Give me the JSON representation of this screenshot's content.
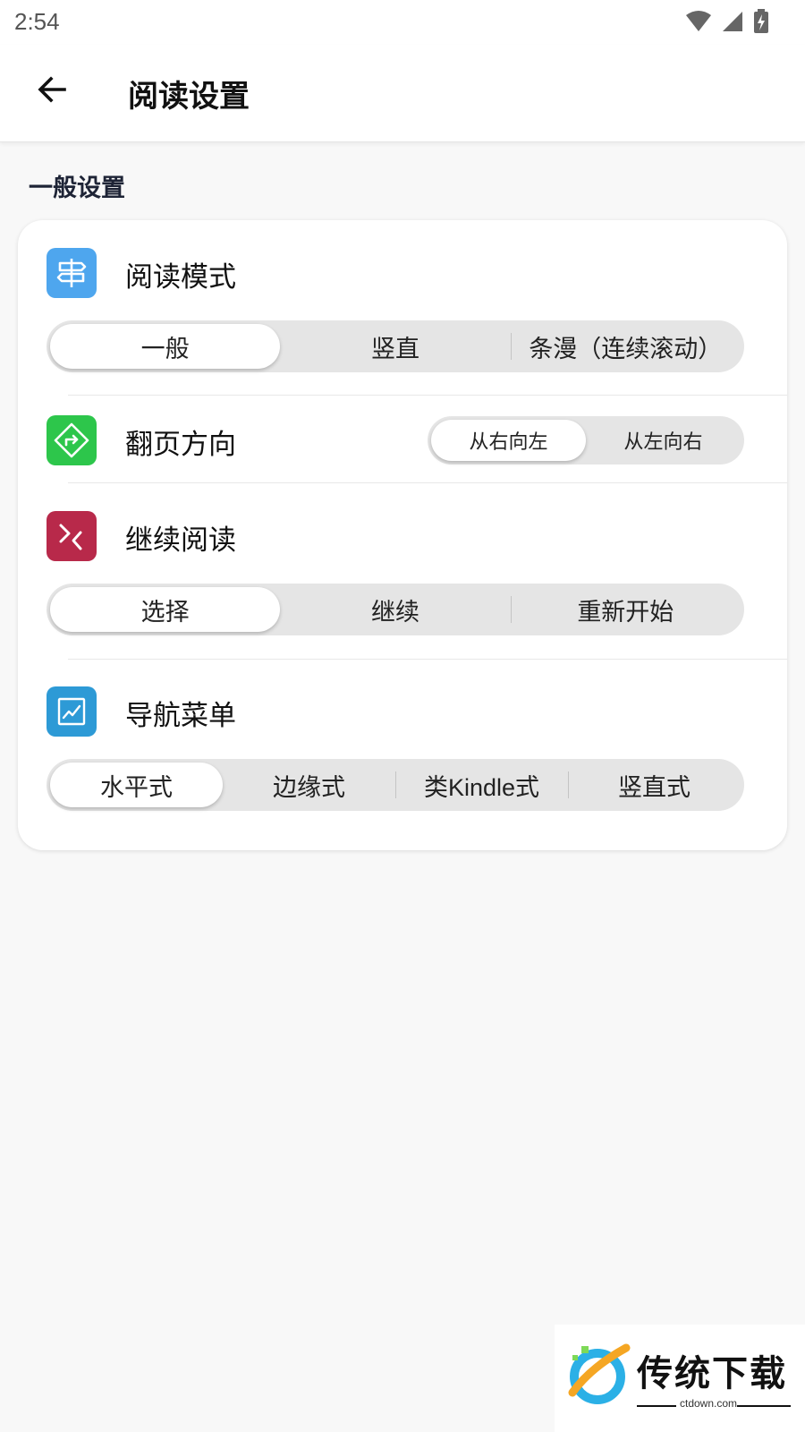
{
  "status_bar": {
    "time": "2:54",
    "icons": [
      "wifi-icon",
      "signal-icon",
      "battery-charging-icon"
    ]
  },
  "header": {
    "title": "阅读设置",
    "back_icon": "arrow-left-icon"
  },
  "section": {
    "title": "一般设置"
  },
  "settings": {
    "reading_mode": {
      "label": "阅读模式",
      "icon": "signpost-icon",
      "icon_color": "#4ea6ee",
      "options": [
        "一般",
        "竖直",
        "条漫（连续滚动）"
      ],
      "selected": "一般"
    },
    "page_direction": {
      "label": "翻页方向",
      "icon": "direction-sign-icon",
      "icon_color": "#2dc64b",
      "options": [
        "从右向左",
        "从左向右"
      ],
      "selected": "从右向左"
    },
    "continue_reading": {
      "label": "继续阅读",
      "icon": "chevrons-icon",
      "icon_color": "#b8294a",
      "options": [
        "选择",
        "继续",
        "重新开始"
      ],
      "selected": "选择"
    },
    "nav_menu": {
      "label": "导航菜单",
      "icon": "line-chart-icon",
      "icon_color": "#2d9ad6",
      "options": [
        "水平式",
        "边缘式",
        "类Kindle式",
        "竖直式"
      ],
      "selected": "水平式"
    }
  },
  "watermark": {
    "brand": "传统下载",
    "domain": "ctdown.com"
  }
}
